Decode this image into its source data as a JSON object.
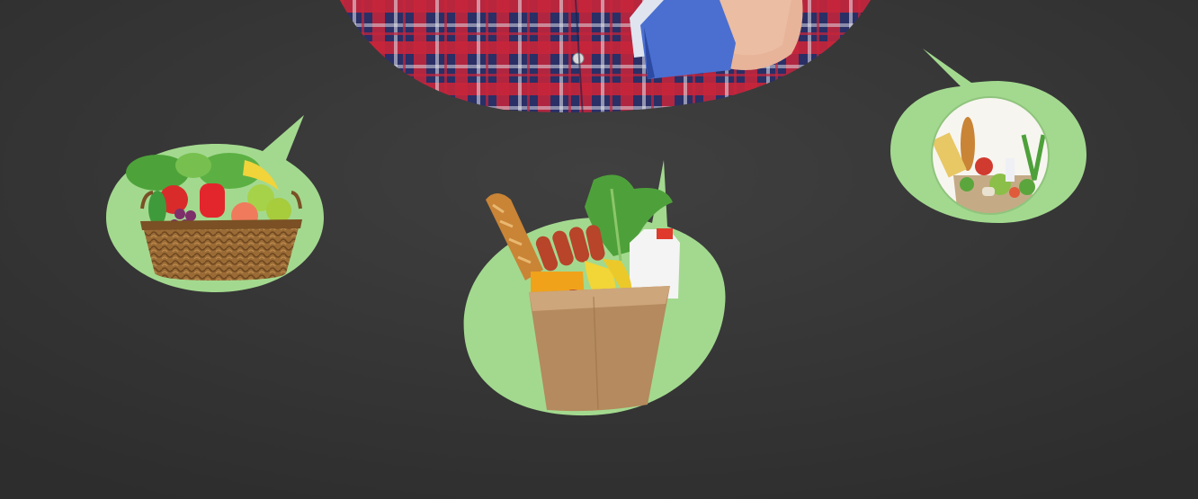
{
  "colors": {
    "background_outer": "#2f2f2f",
    "background_inner": "#3d3d3d",
    "bubble": "#a3d98f",
    "accent_green": "#2fc41d",
    "shirt_red": "#c8253a",
    "shirt_navy": "#252d66",
    "book_blue": "#4a6fd0",
    "skin": "#e9b79c"
  },
  "icons": {
    "person": "person-in-plaid-shirt-illustration",
    "left_bubble": "fruit-basket-illustration",
    "center_bubble": "grocery-bag-illustration",
    "right_bubble": "groceries-photo-thumbnail"
  }
}
